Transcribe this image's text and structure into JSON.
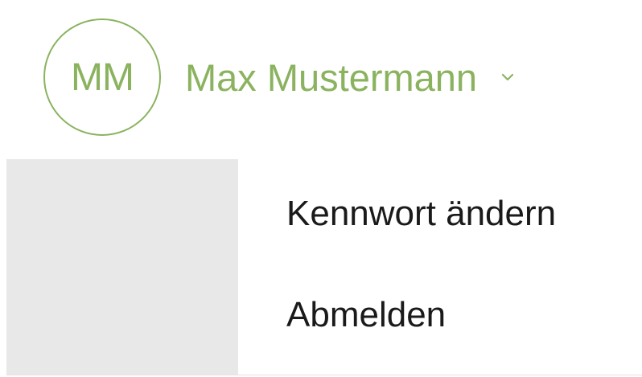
{
  "user": {
    "initials": "MM",
    "name": "Max Mustermann",
    "dropdown_icon": "chevron-down-icon"
  },
  "menu": {
    "items": [
      {
        "label": "Kennwort ändern"
      },
      {
        "label": "Abmelden"
      }
    ]
  },
  "colors": {
    "accent": "#8bb35f",
    "menu_bar": "#e8e8e8",
    "menu_text": "#1a1a1a"
  }
}
